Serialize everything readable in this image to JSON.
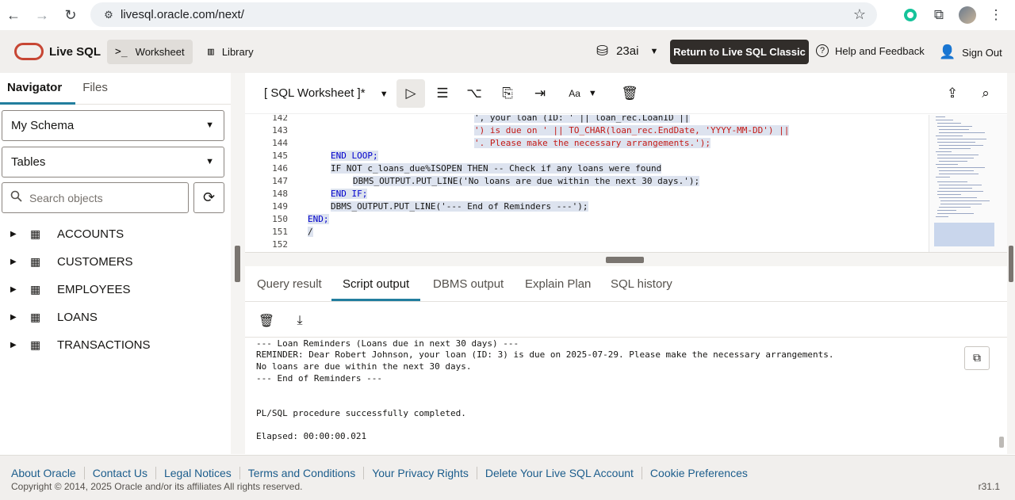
{
  "browser": {
    "url": "livesql.oracle.com/next/",
    "back_icon": "←",
    "forward_icon": "→",
    "reload_icon": "↻",
    "tune_icon": "⚙",
    "star_icon": "☆",
    "extension_icon": "⧉",
    "menu_icon": "⋮"
  },
  "header": {
    "logo_text": "Live SQL",
    "tabs": [
      {
        "label": "Worksheet",
        "icon": ">_"
      },
      {
        "label": "Library",
        "icon": "▥"
      }
    ],
    "db_version": "23ai",
    "db_icon": "⛁",
    "caret": "▼",
    "classic_button": "Return to Live SQL Classic",
    "help_label": "Help and Feedback",
    "help_icon": "?",
    "signout_label": "Sign Out",
    "signout_icon": "👤"
  },
  "navigator": {
    "tabs": [
      "Navigator",
      "Files"
    ],
    "schema_select": "My Schema",
    "object_type_select": "Tables",
    "search_placeholder": "Search objects",
    "search_icon": "🔍",
    "refresh_icon": "⟳",
    "expand_icon": "▶",
    "table_icon": "▦",
    "tables": [
      "ACCOUNTS",
      "CUSTOMERS",
      "EMPLOYEES",
      "LOANS",
      "TRANSACTIONS"
    ]
  },
  "worksheet": {
    "title": "[ SQL Worksheet ]*",
    "toolbar": {
      "run_icon": "▷",
      "run_script_icon": "☰",
      "explain_icon": "⌥",
      "autotrace_icon": "⎘",
      "format_icon": "⇥",
      "font_icon": "Aa",
      "clear_icon": "🗑",
      "share_icon": "⇪",
      "find_icon": "⌕"
    },
    "lines": [
      {
        "num": "142",
        "text": "', your loan (ID: ' || loan_rec.LoanID ||"
      },
      {
        "num": "143",
        "text": "') is due on ' || TO_CHAR(loan_rec.EndDate, 'YYYY-MM-DD') ||"
      },
      {
        "num": "144",
        "text": "'. Please make the necessary arrangements.');"
      },
      {
        "num": "145",
        "text": "END LOOP;"
      },
      {
        "num": "146",
        "text": "IF NOT c_loans_due%ISOPEN THEN -- Check if any loans were found"
      },
      {
        "num": "147",
        "text": "DBMS_OUTPUT.PUT_LINE('No loans are due within the next 30 days.');"
      },
      {
        "num": "148",
        "text": "END IF;"
      },
      {
        "num": "149",
        "text": "DBMS_OUTPUT.PUT_LINE('--- End of Reminders ---');"
      },
      {
        "num": "150",
        "text": "END;"
      },
      {
        "num": "151",
        "text": "/"
      },
      {
        "num": "152",
        "text": ""
      }
    ]
  },
  "output": {
    "tabs": [
      "Query result",
      "Script output",
      "DBMS output",
      "Explain Plan",
      "SQL history"
    ],
    "delete_icon": "🗑",
    "download_icon": "⤓",
    "copy_icon": "⧉",
    "lines": [
      "--- Loan Reminders (Loans due in next 30 days) ---",
      "REMINDER: Dear Robert Johnson, your loan (ID: 3) is due on 2025-07-29. Please make the necessary arrangements.",
      "No loans are due within the next 30 days.",
      "--- End of Reminders ---",
      "",
      "",
      "PL/SQL procedure successfully completed.",
      "",
      "Elapsed: 00:00:00.021"
    ]
  },
  "footer": {
    "links": [
      "About Oracle",
      "Contact Us",
      "Legal Notices",
      "Terms and Conditions",
      "Your Privacy Rights",
      "Delete Your Live SQL Account",
      "Cookie Preferences"
    ],
    "copyright": "Copyright © 2014, 2025 Oracle and/or its affiliates All rights reserved.",
    "version": "r31.1"
  },
  "colors": {
    "oracle_red": "#c74634",
    "tab_accent": "#227e9e",
    "link": "#1c5d8c",
    "dark_button": "#312d2a"
  }
}
